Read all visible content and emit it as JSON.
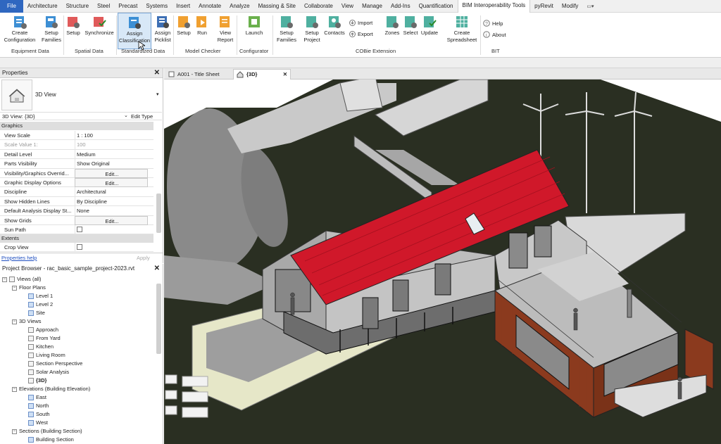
{
  "menu": [
    "File",
    "Architecture",
    "Structure",
    "Steel",
    "Precast",
    "Systems",
    "Insert",
    "Annotate",
    "Analyze",
    "Massing & Site",
    "Collaborate",
    "View",
    "Manage",
    "Add-Ins",
    "Quantification",
    "BIM Interoperability Tools",
    "pyRevit",
    "Modify"
  ],
  "ribbon": {
    "create_configuration": "Create\nConfiguration",
    "setup_families": "Setup\nFamilies",
    "setup": "Setup",
    "synchronize": "Synchronize",
    "assign_classification": "Assign\nClassification",
    "assign_picklist": "Assign\nPicklist",
    "mc_setup": "Setup",
    "run": "Run",
    "view_report": "View\nReport",
    "launch": "Launch",
    "cobie_setup_families": "Setup\nFamilies",
    "setup_project": "Setup\nProject",
    "contacts": "Contacts",
    "import": "Import",
    "export": "Export",
    "zones": "Zones",
    "select": "Select",
    "update": "Update",
    "create_spreadsheet": "Create\nSpreadsheet",
    "help": "Help",
    "about": "About",
    "groups": {
      "equipment_data": "Equipment Data",
      "spatial_data": "Spatial Data",
      "standardized_data": "Standardized Data",
      "model_checker": "Model Checker",
      "configurator": "Configurator",
      "cobie_extension": "COBie Extension",
      "bit": "BIT"
    }
  },
  "properties": {
    "title": "Properties",
    "type_name": "3D View",
    "selector": "3D View: {3D}",
    "edit_type": "Edit Type",
    "section_graphics": "Graphics",
    "rows": [
      {
        "name": "View Scale",
        "value": "1 : 100"
      },
      {
        "name": "Scale Value    1:",
        "value": "100"
      },
      {
        "name": "Detail Level",
        "value": "Medium"
      },
      {
        "name": "Parts Visibility",
        "value": "Show Original"
      },
      {
        "name": "Visibility/Graphics Overrid...",
        "value": "Edit..."
      },
      {
        "name": "Graphic Display Options",
        "value": "Edit..."
      },
      {
        "name": "Discipline",
        "value": "Architectural"
      },
      {
        "name": "Show Hidden Lines",
        "value": "By Discipline"
      },
      {
        "name": "Default Analysis Display St...",
        "value": "None"
      },
      {
        "name": "Show Grids",
        "value": "Edit..."
      },
      {
        "name": "Sun Path",
        "value": ""
      }
    ],
    "section_extents": "Extents",
    "crop_view": "Crop View",
    "help_link": "Properties help",
    "apply": "Apply"
  },
  "browser": {
    "title": "Project Browser - rac_basic_sample_project-2023.rvt",
    "views_all": "Views (all)",
    "floor_plans": "Floor Plans",
    "fp": [
      "Level 1",
      "Level 2",
      "Site"
    ],
    "views3d": "3D Views",
    "v3d": [
      "Approach",
      "From Yard",
      "Kitchen",
      "Living Room",
      "Section Perspective",
      "Solar Analysis",
      "{3D}"
    ],
    "elevations": "Elevations (Building Elevation)",
    "elev": [
      "East",
      "North",
      "South",
      "West"
    ],
    "sections": "Sections (Building Section)",
    "sect": [
      "Building Section"
    ]
  },
  "tabs": {
    "tab1": "A001 - Title Sheet",
    "tab2": "{3D}"
  },
  "colors": {
    "file_blue": "#2f67c0",
    "roof_red": "#d0182a",
    "cladding_brown": "#8b3a1e",
    "terrain": "#2a2f22"
  }
}
